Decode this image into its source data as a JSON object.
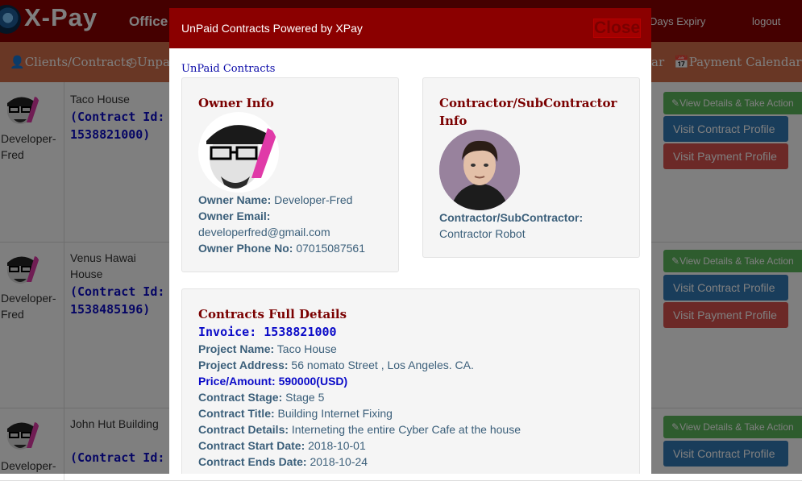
{
  "app": {
    "brand": "X-Pay",
    "office": "Office",
    "days_expiry": "Days Expiry",
    "logout": "logout"
  },
  "nav": {
    "clients": "Clients/Contracts",
    "unpaid": "Unpai",
    "calendar_partial": "ar",
    "payment_calendar": "Payment Calendar"
  },
  "rows": [
    {
      "owner": "Developer-Fred",
      "project": "Taco House",
      "contract_label": "(Contract Id: 1538821000)",
      "btn_details": "View Details & Take Action",
      "btn_contract": "Visit Contract Profile",
      "btn_payment": "Visit Payment Profile"
    },
    {
      "owner": "Developer-Fred",
      "project": "Venus Hawai House",
      "contract_label": "(Contract Id: 1538485196)",
      "btn_details": "View Details & Take Action",
      "btn_contract": "Visit Contract Profile",
      "btn_payment": "Visit Payment Profile"
    },
    {
      "owner": "Developer-",
      "project": "John Hut Building",
      "contract_label": "(Contract Id:",
      "btn_details": "View Details & Take Action",
      "btn_contract": "Visit Contract Profile",
      "btn_payment": ""
    }
  ],
  "modal": {
    "title": "UnPaid Contracts Powered by XPay",
    "close": "Close",
    "subtitle": "UnPaid Contracts",
    "owner_panel": {
      "heading": "Owner Info",
      "name_label": "Owner Name:",
      "name_value": "Developer-Fred",
      "email_label": "Owner Email:",
      "email_value": "developerfred@gmail.com",
      "phone_label": "Owner Phone No:",
      "phone_value": "07015087561"
    },
    "contractor_panel": {
      "heading_line1": "Contractor/SubContractor",
      "heading_line2": "Info",
      "label": "Contractor/SubContractor:",
      "value": "Contractor Robot"
    },
    "details_panel": {
      "heading": "Contracts Full Details",
      "invoice": "Invoice: 1538821000",
      "project_name_label": "Project Name:",
      "project_name_value": "Taco House",
      "project_address_label": "Project Address:",
      "project_address_value": "56 nomato Street , Los Angeles. CA.",
      "price_label": "Price/Amount:",
      "price_value": "590000(USD)",
      "stage_label": "Contract Stage:",
      "stage_value": "Stage 5",
      "title_label": "Contract Title:",
      "title_value": "Building Internet Fixing",
      "details_label": "Contract Details:",
      "details_value": "Interneting the entire Cyber Cafe at the house",
      "start_label": "Contract Start Date:",
      "start_value": "2018-10-01",
      "end_label": "Contract Ends Date:",
      "end_value": "2018-10-24"
    }
  }
}
